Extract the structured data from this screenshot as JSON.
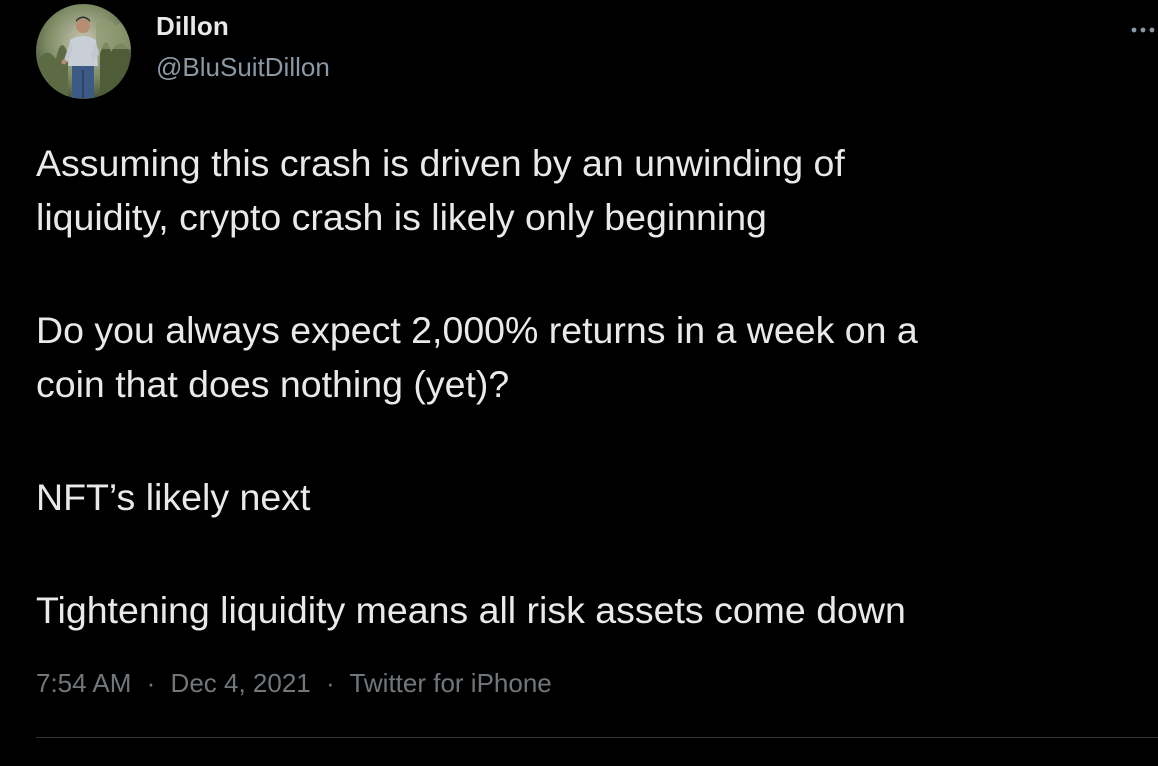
{
  "author": {
    "display_name": "Dillon",
    "handle": "@BluSuitDillon",
    "avatar_icon": "profile-photo"
  },
  "tweet": {
    "paragraphs": [
      {
        "lines": [
          "Assuming this crash is driven by an unwinding of",
          "liquidity, crypto crash is likely only beginning"
        ]
      },
      {
        "lines": [
          "Do you always expect 2,000% returns in a week on a",
          "coin that does nothing (yet)?"
        ]
      },
      {
        "lines": [
          "NFT’s likely next"
        ]
      },
      {
        "lines": [
          "Tightening liquidity means all risk assets come down"
        ]
      }
    ]
  },
  "meta": {
    "time": "7:54 AM",
    "separator": "·",
    "date": "Dec 4, 2021",
    "source": "Twitter for iPhone"
  },
  "menu": {
    "icon": "more-options-icon"
  },
  "colors": {
    "background": "#000000",
    "text_primary": "#e7e9ea",
    "text_secondary": "#71767b",
    "divider": "#2f3336"
  }
}
